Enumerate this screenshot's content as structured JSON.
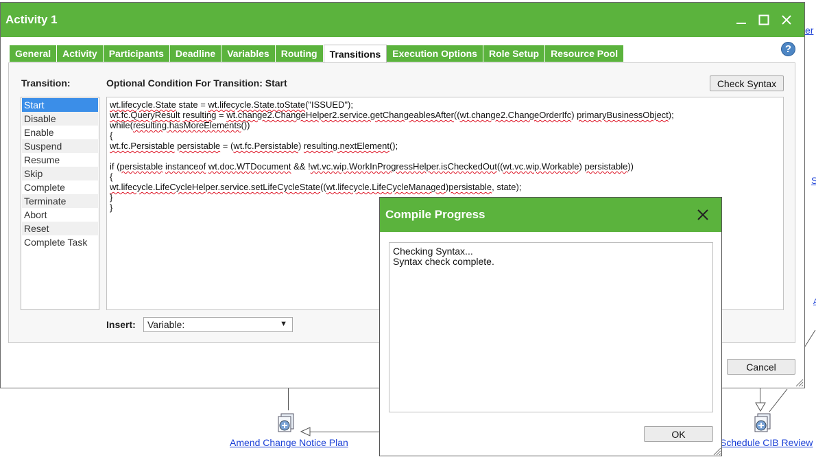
{
  "background": {
    "node_left_label": "Amend Change Notice Plan",
    "node_right_label": "Schedule CIB Review",
    "edge_partial_top": "er",
    "edge_partial_mid": "S",
    "edge_partial_low": "A"
  },
  "dialog": {
    "title": "Activity 1",
    "tabs": [
      {
        "label": "General"
      },
      {
        "label": "Activity"
      },
      {
        "label": "Participants"
      },
      {
        "label": "Deadline"
      },
      {
        "label": "Variables"
      },
      {
        "label": "Routing"
      },
      {
        "label": "Transitions"
      },
      {
        "label": "Execution Options"
      },
      {
        "label": "Role Setup"
      },
      {
        "label": "Resource Pool"
      }
    ],
    "active_tab": "Transitions",
    "help_icon": "?",
    "transition_label": "Transition:",
    "condition_label": "Optional Condition For Transition: Start",
    "check_syntax_label": "Check Syntax",
    "transitions": [
      "Start",
      "Disable",
      "Enable",
      "Suspend",
      "Resume",
      "Skip",
      "Complete",
      "Terminate",
      "Abort",
      "Reset",
      "Complete Task"
    ],
    "selected_transition": "Start",
    "code_lines": [
      "wt.lifecycle.State state = wt.lifecycle.State.toState(\"ISSUED\");",
      "wt.fc.QueryResult resulting = wt.change2.ChangeHelper2.service.getChangeablesAfter((wt.change2.ChangeOrderIfc) primaryBusinessObject);",
      "while(resulting.hasMoreElements())",
      "{",
      "wt.fc.Persistable persistable = (wt.fc.Persistable) resulting.nextElement();",
      "",
      "if (persistable instanceof wt.doc.WTDocument && !wt.vc.wip.WorkInProgressHelper.isCheckedOut((wt.vc.wip.Workable) persistable))",
      "{",
      "wt.lifecycle.LifeCycleHelper.service.setLifeCycleState((wt.lifecycle.LifeCycleManaged)persistable, state);",
      "}",
      "}"
    ],
    "insert_label": "Insert:",
    "insert_value": "Variable:",
    "cancel_label": "Cancel"
  },
  "compile": {
    "title": "Compile Progress",
    "output_lines": [
      "Checking Syntax...",
      "Syntax check complete."
    ],
    "ok_label": "OK"
  },
  "colors": {
    "accent_green": "#5bb33d",
    "selection_blue": "#3b8ee8",
    "link_blue": "#1a3fd6"
  }
}
